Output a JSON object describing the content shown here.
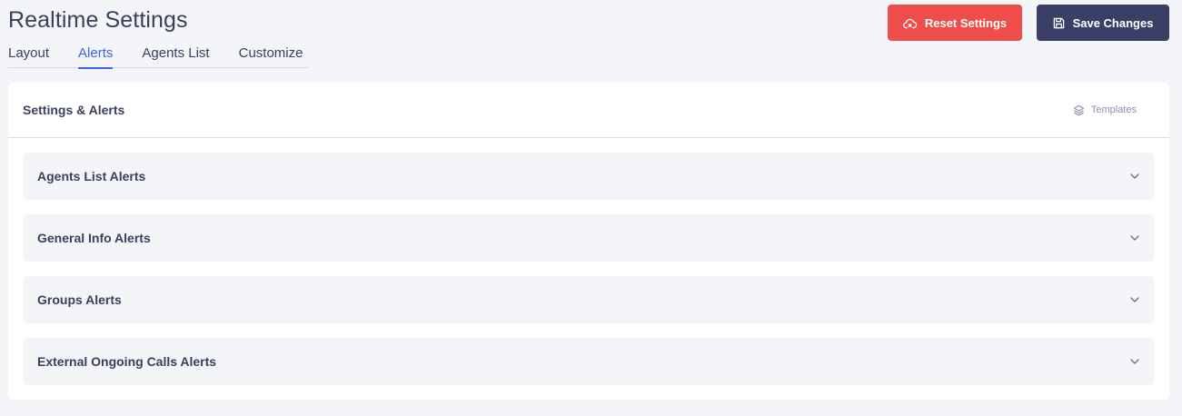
{
  "header": {
    "title": "Realtime Settings",
    "reset_label": "Reset Settings",
    "save_label": "Save Changes",
    "reset_color": "#ef4d4a",
    "save_color": "#3b3f66"
  },
  "tabs": [
    {
      "label": "Layout",
      "active": false
    },
    {
      "label": "Alerts",
      "active": true
    },
    {
      "label": "Agents List",
      "active": false
    },
    {
      "label": "Customize",
      "active": false
    }
  ],
  "accent_color": "#3f63e8",
  "card": {
    "title": "Settings & Alerts",
    "templates_label": "Templates",
    "sections": [
      {
        "label": "Agents List Alerts",
        "icon": "chevron-down-icon"
      },
      {
        "label": "General Info Alerts",
        "icon": "chevron-down-icon"
      },
      {
        "label": "Groups Alerts",
        "icon": "chevron-down-icon"
      },
      {
        "label": "External Ongoing Calls Alerts",
        "icon": "chevron-down-icon"
      }
    ]
  }
}
